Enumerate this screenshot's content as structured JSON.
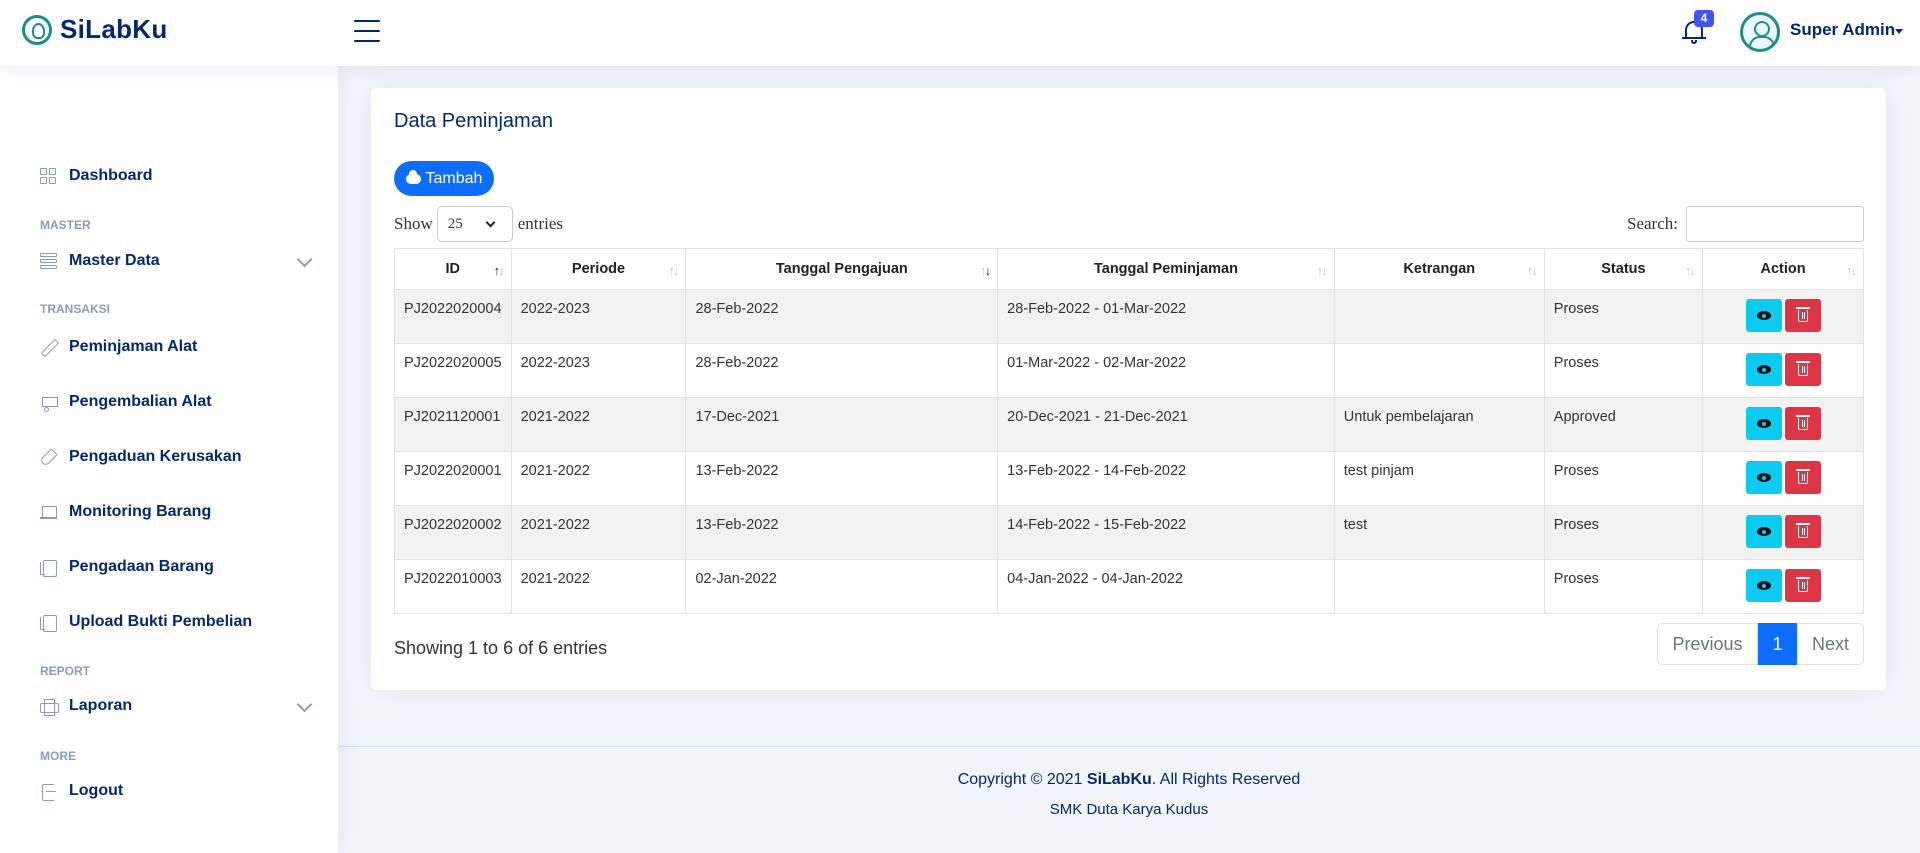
{
  "app": {
    "name": "SiLabKu"
  },
  "header": {
    "notification_count": "4",
    "user_name": "Super Admin"
  },
  "sidebar": {
    "items": [
      {
        "label": "Dashboard"
      },
      {
        "heading": "MASTER"
      },
      {
        "label": "Master Data"
      },
      {
        "heading": "TRANSAKSI"
      },
      {
        "label": "Peminjaman Alat"
      },
      {
        "label": "Pengembalian Alat"
      },
      {
        "label": "Pengaduan Kerusakan"
      },
      {
        "label": "Monitoring Barang"
      },
      {
        "label": "Pengadaan Barang"
      },
      {
        "label": "Upload Bukti Pembelian"
      },
      {
        "heading": "REPORT"
      },
      {
        "label": "Laporan"
      },
      {
        "heading": "MORE"
      },
      {
        "label": "Logout"
      }
    ]
  },
  "main": {
    "title": "Data Peminjaman",
    "add_button": "Tambah",
    "show_label": "Show",
    "page_length": "25",
    "entries_label": "entries",
    "search_label": "Search:",
    "columns": [
      "ID",
      "Periode",
      "Tanggal Pengajuan",
      "Tanggal Peminjaman",
      "Ketrangan",
      "Status",
      "Action"
    ],
    "rows": [
      [
        "PJ2022020004",
        "2022-2023",
        "28-Feb-2022",
        "28-Feb-2022 - 01-Mar-2022",
        "",
        "Proses"
      ],
      [
        "PJ2022020005",
        "2022-2023",
        "28-Feb-2022",
        "01-Mar-2022 - 02-Mar-2022",
        "",
        "Proses"
      ],
      [
        "PJ2021120001",
        "2021-2022",
        "17-Dec-2021",
        "20-Dec-2021 - 21-Dec-2021",
        "Untuk pembelajaran",
        "Approved"
      ],
      [
        "PJ2022020001",
        "2021-2022",
        "13-Feb-2022",
        "13-Feb-2022 - 14-Feb-2022",
        "test pinjam",
        "Proses"
      ],
      [
        "PJ2022020002",
        "2021-2022",
        "13-Feb-2022",
        "14-Feb-2022 - 15-Feb-2022",
        "test",
        "Proses"
      ],
      [
        "PJ2022010003",
        "2021-2022",
        "02-Jan-2022",
        "04-Jan-2022 - 04-Jan-2022",
        "",
        "Proses"
      ]
    ],
    "info": "Showing 1 to 6 of 6 entries",
    "pagination": {
      "previous": "Previous",
      "current": "1",
      "next": "Next"
    }
  },
  "footer": {
    "copyright_prefix": "Copyright © 2021 ",
    "copyright_brand": "SiLabKu",
    "copyright_suffix": ". All Rights Reserved",
    "school": "SMK Duta Karya Kudus"
  },
  "colors": {
    "primary": "#0d6efd",
    "navy": "#012970",
    "view": "#0dcaf0",
    "delete": "#dc3545"
  }
}
